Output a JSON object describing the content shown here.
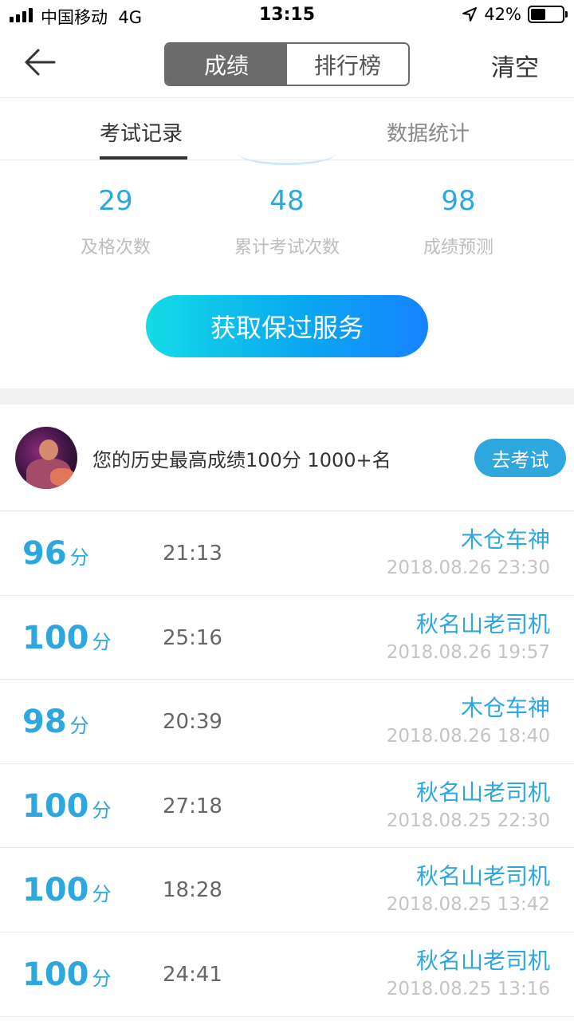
{
  "status_bar": {
    "carrier": "中国移动",
    "network": "4G",
    "time": "13:15",
    "battery": "42%",
    "battery_level": 0.42
  },
  "nav": {
    "segments": [
      "成绩",
      "排行榜"
    ],
    "active_segment": 0,
    "clear_label": "清空"
  },
  "tabs": [
    "考试记录",
    "数据统计"
  ],
  "stats": [
    {
      "value": "29",
      "label": "及格次数"
    },
    {
      "value": "48",
      "label": "累计考试次数"
    },
    {
      "value": "98",
      "label": "成绩预测"
    }
  ],
  "cta_label": "获取保过服务",
  "best": {
    "text": "您的历史最高成绩100分  1000+名",
    "button": "去考试"
  },
  "records": [
    {
      "score": "96",
      "unit": "分",
      "duration": "21:13",
      "name": "木仓车神",
      "date": "2018.08.26 23:30"
    },
    {
      "score": "100",
      "unit": "分",
      "duration": "25:16",
      "name": "秋名山老司机",
      "date": "2018.08.26 19:57"
    },
    {
      "score": "98",
      "unit": "分",
      "duration": "20:39",
      "name": "木仓车神",
      "date": "2018.08.26 18:40"
    },
    {
      "score": "100",
      "unit": "分",
      "duration": "27:18",
      "name": "秋名山老司机",
      "date": "2018.08.25 22:30"
    },
    {
      "score": "100",
      "unit": "分",
      "duration": "18:28",
      "name": "秋名山老司机",
      "date": "2018.08.25 13:42"
    },
    {
      "score": "100",
      "unit": "分",
      "duration": "24:41",
      "name": "秋名山老司机",
      "date": "2018.08.25 13:16"
    }
  ],
  "colors": {
    "accent": "#2ea7df",
    "segment_active": "#6b6b6b",
    "cta_start": "#13dbe6",
    "cta_end": "#1683ff"
  }
}
